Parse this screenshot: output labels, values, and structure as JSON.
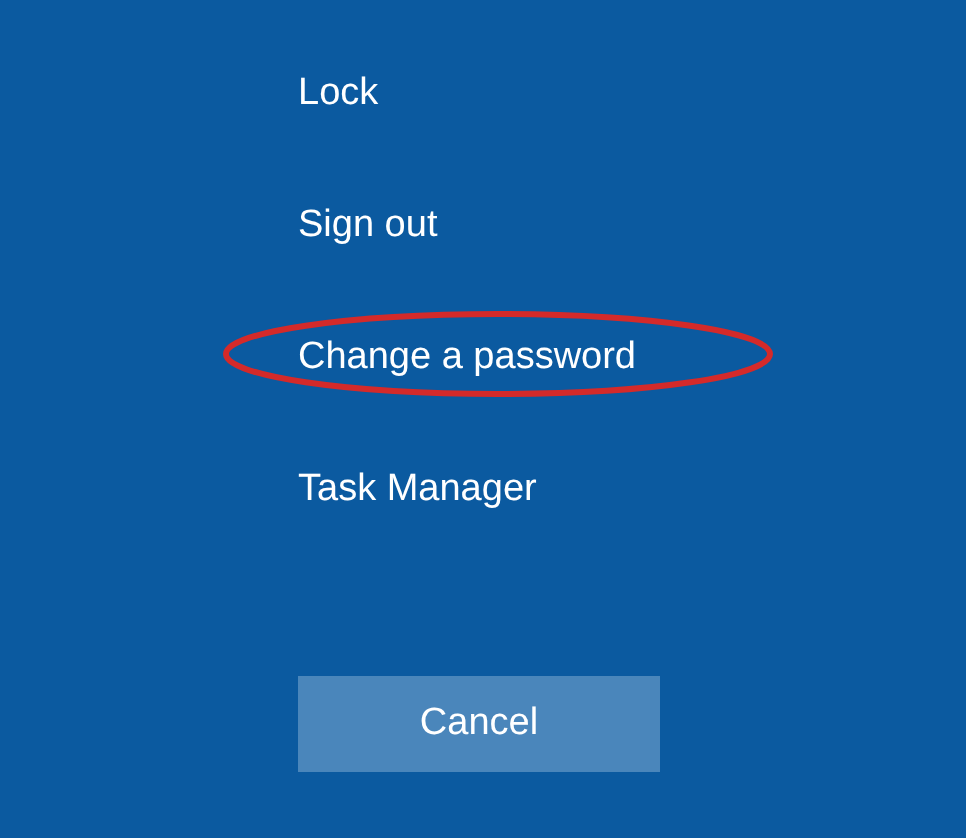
{
  "menu": [
    {
      "label": "Lock",
      "circled": false
    },
    {
      "label": "Sign out",
      "circled": false
    },
    {
      "label": "Change a password",
      "circled": true
    },
    {
      "label": "Task Manager",
      "circled": false
    }
  ],
  "cancel_button": "Cancel"
}
